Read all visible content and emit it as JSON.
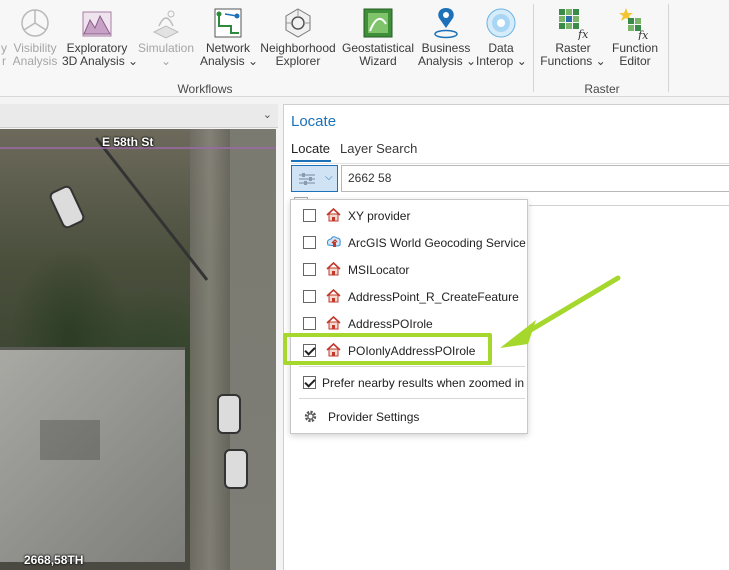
{
  "ribbon": {
    "buttons": [
      {
        "id": "visibility",
        "line1": "Visibility",
        "line2": "Analysis",
        "prefix1": "y",
        "prefix2": "r",
        "disabled": true
      },
      {
        "id": "exploratory",
        "line1": "Exploratory",
        "line2": "3D Analysis",
        "dropdown": true
      },
      {
        "id": "simulation",
        "line1": "Simulation",
        "line2": "",
        "dropdown": true,
        "disabled": true
      },
      {
        "id": "network",
        "line1": "Network",
        "line2": "Analysis",
        "dropdown": true
      },
      {
        "id": "neighborhood",
        "line1": "Neighborhood",
        "line2": "Explorer"
      },
      {
        "id": "geostat",
        "line1": "Geostatistical",
        "line2": "Wizard"
      },
      {
        "id": "business",
        "line1": "Business",
        "line2": "Analysis",
        "dropdown": true
      },
      {
        "id": "interop",
        "line1": "Data",
        "line2": "Interop",
        "dropdown": true
      },
      {
        "id": "raster-functions",
        "line1": "Raster",
        "line2": "Functions",
        "dropdown": true
      },
      {
        "id": "function-editor",
        "line1": "Function",
        "line2": "Editor"
      }
    ],
    "groups": {
      "workflows": "Workflows",
      "raster": "Raster"
    },
    "dropdown_glyph": "⌄"
  },
  "map": {
    "street_label": "E 58th St",
    "coord_label": "2668,58TH"
  },
  "locate": {
    "title": "Locate",
    "tabs": [
      "Locate",
      "Layer Search"
    ],
    "search_value": "2662 58"
  },
  "dropdown": {
    "providers": [
      {
        "label": "XY provider",
        "checked": false,
        "icon": "house-icon"
      },
      {
        "label": "ArcGIS World Geocoding Service",
        "checked": false,
        "icon": "globe-icon"
      },
      {
        "label": "MSILocator",
        "checked": false,
        "icon": "house-icon"
      },
      {
        "label": "AddressPoint_R_CreateFeature",
        "checked": false,
        "icon": "house-icon"
      },
      {
        "label": "AddressPOIrole",
        "checked": false,
        "icon": "house-icon"
      },
      {
        "label": "POIonlyAddressPOIrole",
        "checked": true,
        "icon": "house-icon"
      }
    ],
    "prefer_nearby": {
      "label": "Prefer nearby results when zoomed in",
      "checked": true
    },
    "provider_settings": "Provider Settings"
  },
  "colors": {
    "accent": "#1d71b8",
    "highlight": "#a6d72c"
  }
}
